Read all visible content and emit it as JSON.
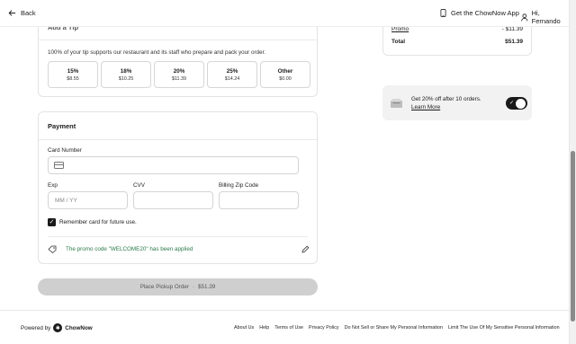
{
  "header": {
    "back_label": "Back",
    "get_app_label": "Get the ChowNow App",
    "user_greeting": "Hi, Fernando"
  },
  "tip": {
    "title": "Add a Tip",
    "description": "100% of your tip supports our restaurant and its staff who prepare and pack your order.",
    "options": [
      {
        "pct": "15%",
        "amount": "$8.55"
      },
      {
        "pct": "18%",
        "amount": "$10.25"
      },
      {
        "pct": "20%",
        "amount": "$11.39"
      },
      {
        "pct": "25%",
        "amount": "$14.24"
      },
      {
        "pct": "Other",
        "amount": "$0.00"
      }
    ]
  },
  "payment": {
    "title": "Payment",
    "card_number_label": "Card Number",
    "exp_label": "Exp",
    "exp_placeholder": "MM / YY",
    "cvv_label": "CVV",
    "zip_label": "Billing Zip Code",
    "remember_label": "Remember card for future use.",
    "remember_checked": true,
    "promo_applied_text": "The promo code \"WELCOME20\" has been applied"
  },
  "place_order": {
    "label": "Place Pickup Order",
    "separator": "·",
    "amount": "$51.39"
  },
  "summary": {
    "promo_label": "Promo",
    "promo_value": "- $11.39",
    "total_label": "Total",
    "total_value": "$51.39"
  },
  "reward": {
    "line1": "Get 20% off after 10 orders.",
    "learn_more": "Learn More",
    "toggle_on": true
  },
  "footer": {
    "powered_by": "Powered by",
    "brand": "ChowNow",
    "links": [
      "About Us",
      "Help",
      "Terms of Use",
      "Privacy Policy",
      "Do Not Sell or Share My Personal Information",
      "Limit The Use Of My Sensitive Personal Information"
    ]
  },
  "colors": {
    "promo_green": "#2a7a4a",
    "button_disabled": "#cfcfcf",
    "toggle_on": "#1a1a1a"
  }
}
